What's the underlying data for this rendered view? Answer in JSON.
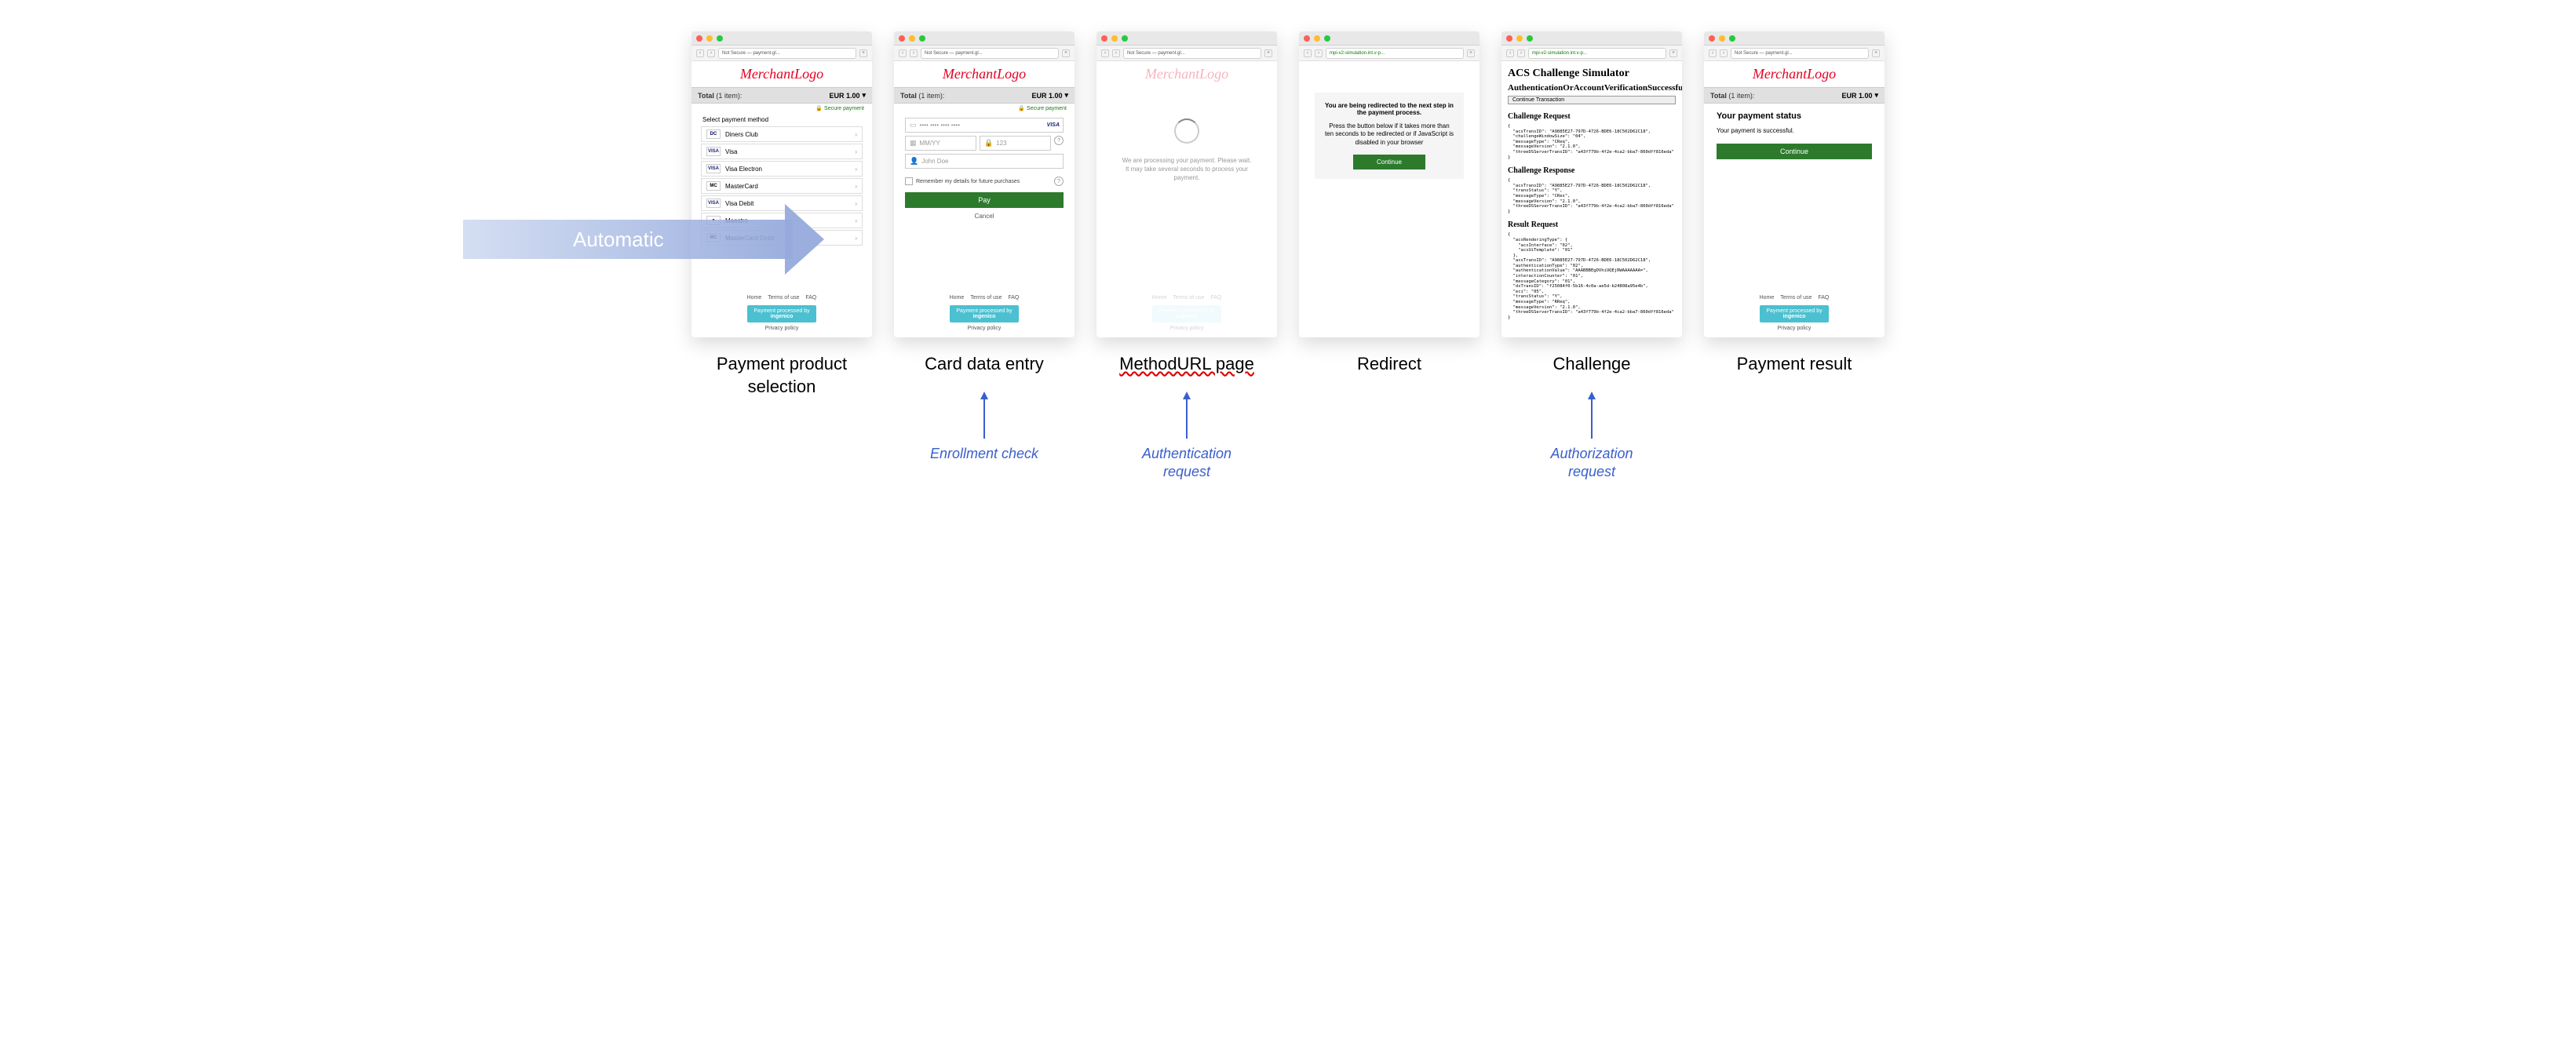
{
  "browser": {
    "not_secure": "Not Secure — payment.gl...",
    "mpi_url": "mpi-v2-simulation.int.v-p...",
    "back": "‹",
    "fwd": "›",
    "close": "×"
  },
  "logo_text": "MerchantLogo",
  "total_row": {
    "label_prefix": "Total",
    "label_suffix": "(1 item):",
    "amount": "EUR 1.00",
    "dropdown": "▾"
  },
  "secure_payment": "🔒 Secure payment",
  "footer": {
    "home": "Home",
    "terms": "Terms of use",
    "faq": "FAQ",
    "processed": "Payment processed by",
    "brand": "ingenico",
    "privacy": "Privacy policy"
  },
  "panel1": {
    "select_label": "Select payment method",
    "methods": [
      {
        "icon": "DC",
        "icon_color": "#006",
        "name": "Diners Club"
      },
      {
        "icon": "VISA",
        "icon_color": "#1a1f71",
        "name": "Visa"
      },
      {
        "icon": "VISA",
        "icon_color": "#1a1f71",
        "name": "Visa Electron"
      },
      {
        "icon": "MC",
        "icon_color": "#000",
        "name": "MasterCard"
      },
      {
        "icon": "VISA",
        "icon_color": "#1a1f71",
        "name": "Visa Debit"
      },
      {
        "icon": "●",
        "icon_color": "#000",
        "name": "Maestro"
      },
      {
        "icon": "MC",
        "icon_color": "#000",
        "name": "MasterCard Debit"
      }
    ]
  },
  "panel2": {
    "card_placeholder": "•••• •••• •••• ••••",
    "visa": "VISA",
    "expiry": "MM/YY",
    "cvv": "123",
    "name": "John Doe",
    "remember": "Remember my details for future purchases",
    "help": "?",
    "pay": "Pay",
    "cancel": "Cancel"
  },
  "panel3": {
    "processing": "We are processing your payment. Please wait. It may take several seconds to process your payment."
  },
  "panel4": {
    "header": "You are being redirected to the next step in the payment process.",
    "sub": "Press the button below if it takes more than ten seconds to be redirected or if JavaScript is disabled in your browser",
    "continue": "Continue"
  },
  "panel5": {
    "title": "ACS Challenge Simulator",
    "subtitle": "AuthenticationOrAccountVerificationSuccessful",
    "btn": "Continue Transaction",
    "h_req": "Challenge Request",
    "req_json": "{\n  \"acsTransID\": \"A9885E27-797D-4726-BDE6-18C502D62C18\",\n  \"challengeWindowSize\": \"04\",\n  \"messageType\": \"CReq\",\n  \"messageVersion\": \"2.1.0\",\n  \"threeDSServerTransID\": \"a43f779b-4f2e-4ca2-bba7-860dff816eda\"\n}",
    "h_res": "Challenge Response",
    "res_json": "{\n  \"acsTransID\": \"A9885E27-797D-4726-BDE6-18C502D62C18\",\n  \"transStatus\": \"Y\",\n  \"messageType\": \"CRes\",\n  \"messageVersion\": \"2.1.0\",\n  \"threeDSServerTransID\": \"a43f779b-4f2e-4ca2-bba7-860dff816eda\"\n}",
    "h_result": "Result Request",
    "result_json": "{\n  \"acsRenderingType\": {\n    \"acsInterface\": \"02\",\n    \"acsUiTemplate\": \"01\"\n  },\n  \"acsTransID\": \"A9885E27-797D-4726-BDE6-18C502D62C18\",\n  \"authenticationType\": \"02\",\n  \"authenticationValue\": \"AAABBBEgDVhiUQEjRWAAAAAAA=\",\n  \"interactionCounter\": \"01\",\n  \"messageCategory\": \"01\",\n  \"dsTransID\": \"f25084f0-5b16-4c0a-ae5d-b24808a95e4b\",\n  \"eci\": \"05\",\n  \"transStatus\": \"Y\",\n  \"messageType\": \"RReq\",\n  \"messageVersion\": \"2.1.0\",\n  \"threeDSServerTransID\": \"a43f779b-4f2e-4ca2-bba7-860dff816eda\"\n}"
  },
  "panel6": {
    "heading": "Your payment status",
    "msg": "Your payment is successful.",
    "continue": "Continue"
  },
  "captions": {
    "c1a": "Payment product",
    "c1b": "selection",
    "c2": "Card data entry",
    "c3": "MethodURL page",
    "c4": "Redirect",
    "c5": "Challenge",
    "c6": "Payment result"
  },
  "sub_labels": {
    "enroll": "Enrollment check",
    "auth_req_a": "Authentication",
    "auth_req_b": "request",
    "authz_a": "Authorization",
    "authz_b": "request"
  },
  "auto_label": "Automatic"
}
